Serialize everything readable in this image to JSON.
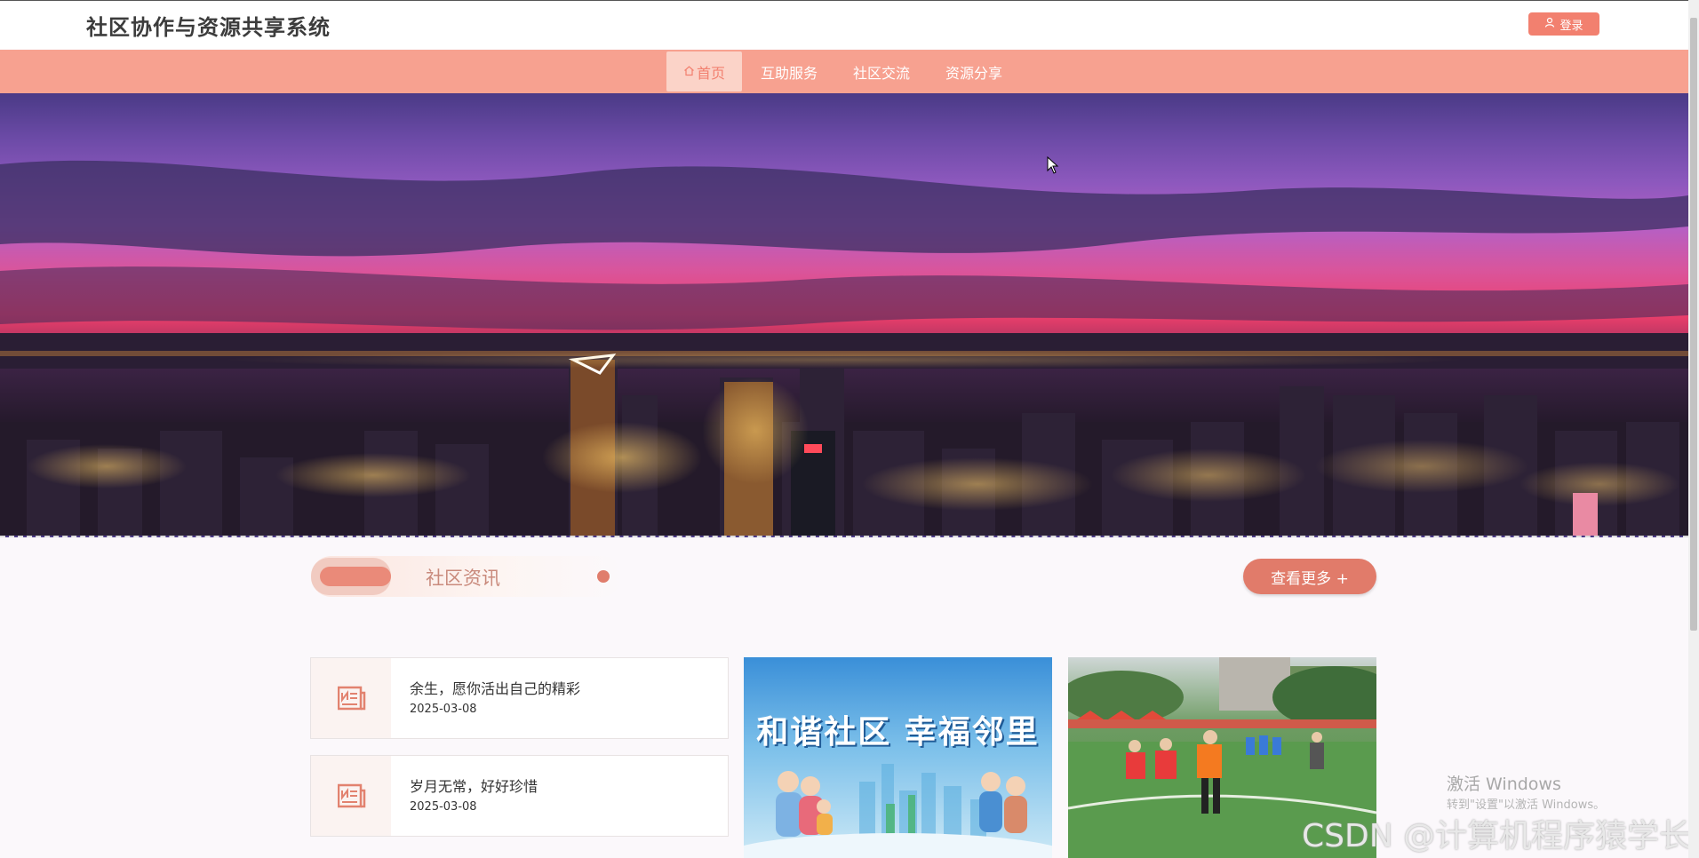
{
  "header": {
    "site_title": "社区协作与资源共享系统",
    "login_label": "登录"
  },
  "nav": {
    "items": [
      {
        "label": "首页",
        "active": true
      },
      {
        "label": "互助服务",
        "active": false
      },
      {
        "label": "社区交流",
        "active": false
      },
      {
        "label": "资源分享",
        "active": false
      }
    ]
  },
  "news_section": {
    "title": "社区资讯",
    "more_label": "查看更多 +",
    "items": [
      {
        "title": "余生，愿你活出自己的精彩",
        "date": "2025-03-08"
      },
      {
        "title": "岁月无常，好好珍惜",
        "date": "2025-03-08"
      }
    ],
    "picture_cards": [
      {
        "caption": "和谐社区 幸福邻里"
      },
      {
        "caption": ""
      }
    ]
  },
  "overlays": {
    "windows_activation": "激活 Windows",
    "windows_activation_hint": "转到\"设置\"以激活 Windows。",
    "csdn_watermark": "CSDN @计算机程序猿学长"
  },
  "colors": {
    "accent": "#f2806f",
    "nav_bg": "#f7a190",
    "active_nav_bg": "#fbd3c8",
    "more_button": "#e17b6a",
    "section_title": "#c98a7c"
  },
  "icons": [
    "user-icon",
    "home-icon",
    "newspaper-icon",
    "mouse-cursor-icon"
  ]
}
